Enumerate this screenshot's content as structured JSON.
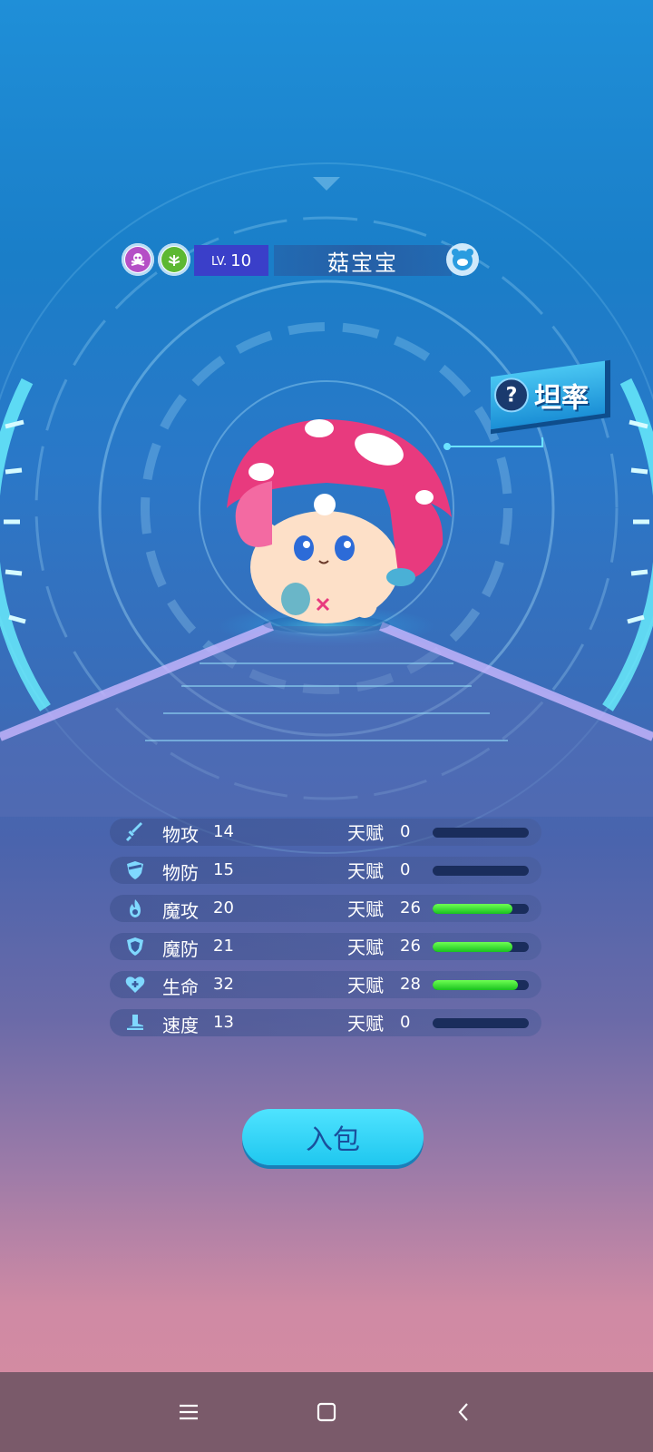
{
  "header": {
    "type_icons": [
      "skull-icon",
      "grass-leaf-icon"
    ],
    "level_prefix": "LV.",
    "level": "10",
    "name": "菇宝宝",
    "pet_icon": "pet-face-icon"
  },
  "trait": {
    "icon": "question-icon",
    "icon_text": "?",
    "label": "坦率"
  },
  "stats": [
    {
      "icon": "sword-icon",
      "name": "物攻",
      "value": "14",
      "talent_label": "天赋",
      "talent": "0",
      "fill": 0.0
    },
    {
      "icon": "shield-icon",
      "name": "物防",
      "value": "15",
      "talent_label": "天赋",
      "talent": "0",
      "fill": 0.0
    },
    {
      "icon": "fire-icon",
      "name": "魔攻",
      "value": "20",
      "talent_label": "天赋",
      "talent": "26",
      "fill": 0.83
    },
    {
      "icon": "magic-shield-icon",
      "name": "魔防",
      "value": "21",
      "talent_label": "天赋",
      "talent": "26",
      "fill": 0.83
    },
    {
      "icon": "heart-plus-icon",
      "name": "生命",
      "value": "32",
      "talent_label": "天赋",
      "talent": "28",
      "fill": 0.89
    },
    {
      "icon": "boot-icon",
      "name": "速度",
      "value": "13",
      "talent_label": "天赋",
      "talent": "0",
      "fill": 0.0
    }
  ],
  "action": {
    "pack_label": "入包"
  },
  "navbar": {
    "menu_icon": "menu-icon",
    "home_icon": "home-square-icon",
    "back_icon": "back-chevron-icon"
  },
  "colors": {
    "accent": "#1fc7ef",
    "bar_fill": "#2ed42a",
    "bar_track": "#1a2d5c",
    "level_bg": "#3a3fc9"
  }
}
